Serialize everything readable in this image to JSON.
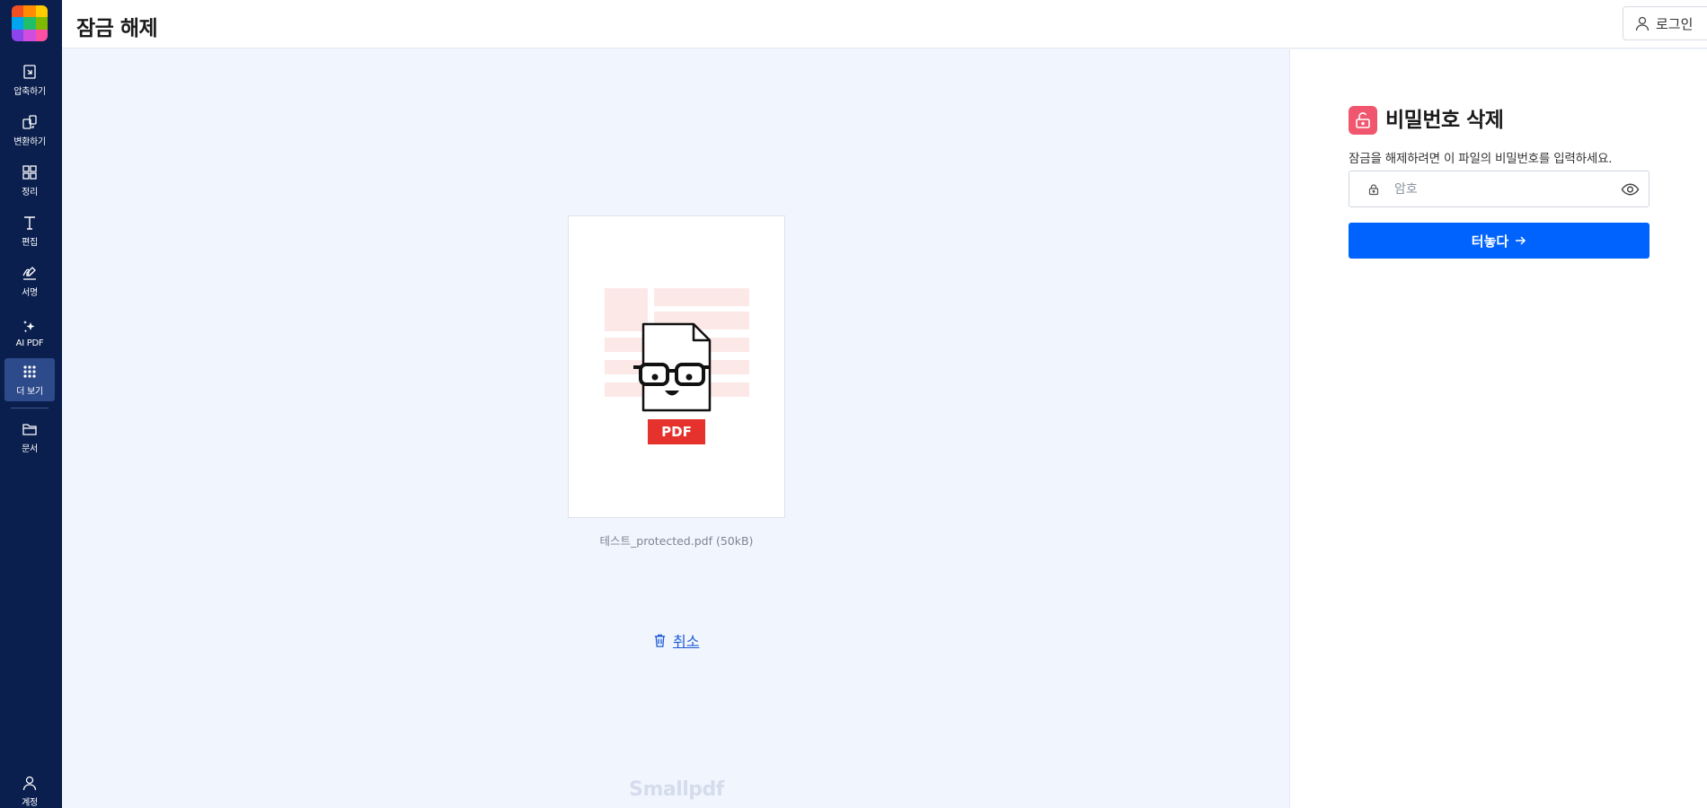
{
  "app": {
    "brand": "Smallpdf",
    "logo_colors": [
      "#f25022",
      "#ff8c00",
      "#ffcc00",
      "#00a4ef",
      "#1fbf6a",
      "#7fba00",
      "#8e44ec",
      "#d14de0",
      "#ff4fa3"
    ]
  },
  "sidebar": {
    "items": [
      {
        "label": "압축하기",
        "icon": "compress-icon"
      },
      {
        "label": "변환하기",
        "icon": "convert-icon"
      },
      {
        "label": "정리",
        "icon": "organize-grid-icon"
      },
      {
        "label": "편집",
        "icon": "text-edit-icon"
      },
      {
        "label": "서명",
        "icon": "signature-icon"
      },
      {
        "label": "AI PDF",
        "icon": "sparkles-icon"
      },
      {
        "label": "더 보기",
        "icon": "more-apps-icon",
        "active": true
      },
      {
        "label": "문서",
        "icon": "folder-icon"
      },
      {
        "label": "계정",
        "icon": "account-icon"
      }
    ]
  },
  "header": {
    "title": "잠금 해제",
    "login_label": "로그인"
  },
  "main": {
    "file_name": "테스트_protected.pdf (50kB)",
    "file_badge": "PDF",
    "cancel_label": "취소"
  },
  "panel": {
    "title": "비밀번호 삭제",
    "description": "잠금을 해제하려면 이 파일의 비밀번호를 입력하세요.",
    "password_placeholder": "암호",
    "password_value": "",
    "submit_label": "터놓다"
  },
  "colors": {
    "sidebar_bg": "#0a1f4d",
    "sidebar_active": "#2d4a8b",
    "main_bg": "#f1f6fe",
    "primary_button": "#0163fe",
    "unlock_icon_bg": "#f0576e",
    "pdf_badge": "#e5322d",
    "link": "#1f5bd6"
  }
}
